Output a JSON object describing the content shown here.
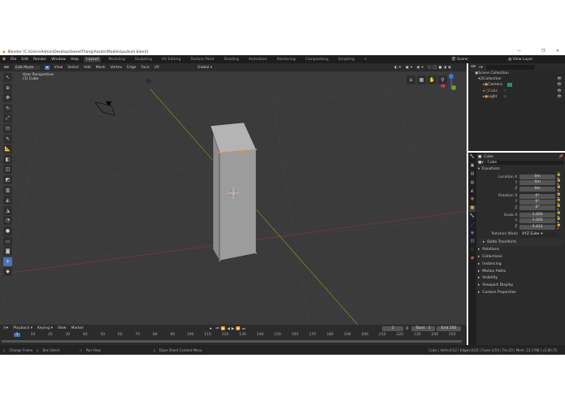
{
  "window": {
    "title": "Blender [C:\\Users\\Admin\\Desktop\\SweetThang\\Assets\\Models\\podium.blend]",
    "min": "—",
    "max": "❐",
    "close": "✕"
  },
  "menu": [
    "File",
    "Edit",
    "Render",
    "Window",
    "Help"
  ],
  "workspaces": [
    "Layout",
    "Modeling",
    "Sculpting",
    "UV Editing",
    "Texture Paint",
    "Shading",
    "Animation",
    "Rendering",
    "Compositing",
    "Scripting",
    "+"
  ],
  "scene": "Scene",
  "view_layer": "View Layer",
  "viewport": {
    "mode": "Edit Mode",
    "menus": [
      "View",
      "Select",
      "Add",
      "Mesh",
      "Vertex",
      "Edge",
      "Face",
      "UV"
    ],
    "orientation": "Global",
    "info_line1": "User Perspective",
    "info_line2": "(1) Cube"
  },
  "outliner": {
    "search_placeholder": "",
    "items": [
      {
        "label": "Scene Collection"
      },
      {
        "label": "Collection"
      },
      {
        "label": "Camera"
      },
      {
        "label": "Cube"
      },
      {
        "label": "Light"
      }
    ]
  },
  "properties": {
    "object_name": "Cube",
    "data_name": "Cube",
    "transform_label": "Transform",
    "fields": [
      {
        "label": "Location X",
        "value": "0m"
      },
      {
        "label": "Y",
        "value": "0m"
      },
      {
        "label": "Z",
        "value": "0m"
      },
      {
        "label": "Rotation X",
        "value": "0°"
      },
      {
        "label": "Y",
        "value": "0°"
      },
      {
        "label": "Z",
        "value": "0°"
      },
      {
        "label": "Scale X",
        "value": "1.000"
      },
      {
        "label": "Y",
        "value": "1.000"
      },
      {
        "label": "Z",
        "value": "3.412"
      }
    ],
    "rotation_mode_label": "Rotation Mode",
    "rotation_mode": "XYZ Euler",
    "delta": "Delta Transform",
    "panels": [
      "Relations",
      "Collections",
      "Instancing",
      "Motion Paths",
      "Visibility",
      "Viewport Display",
      "Custom Properties"
    ]
  },
  "timeline": {
    "menus": [
      "Playback",
      "Keying",
      "View",
      "Marker"
    ],
    "current_frame": "1",
    "start_label": "Start",
    "start": "1",
    "end_label": "End",
    "end": "250",
    "ticks": [
      "1",
      "10",
      "20",
      "30",
      "40",
      "50",
      "60",
      "70",
      "80",
      "90",
      "100",
      "110",
      "120",
      "130",
      "140",
      "150",
      "160",
      "170",
      "180",
      "190",
      "200",
      "210",
      "220",
      "230",
      "240",
      "250"
    ]
  },
  "status": {
    "hints": [
      "Change Frame",
      "Box Select",
      "Pan View",
      "Dope Sheet Context Menu"
    ],
    "stats": "Cube | Verts:4/12 | Edges:4/20 | Faces:1/10 | Tris:20 | Mem: 23.5 MB | v2.80.75"
  }
}
